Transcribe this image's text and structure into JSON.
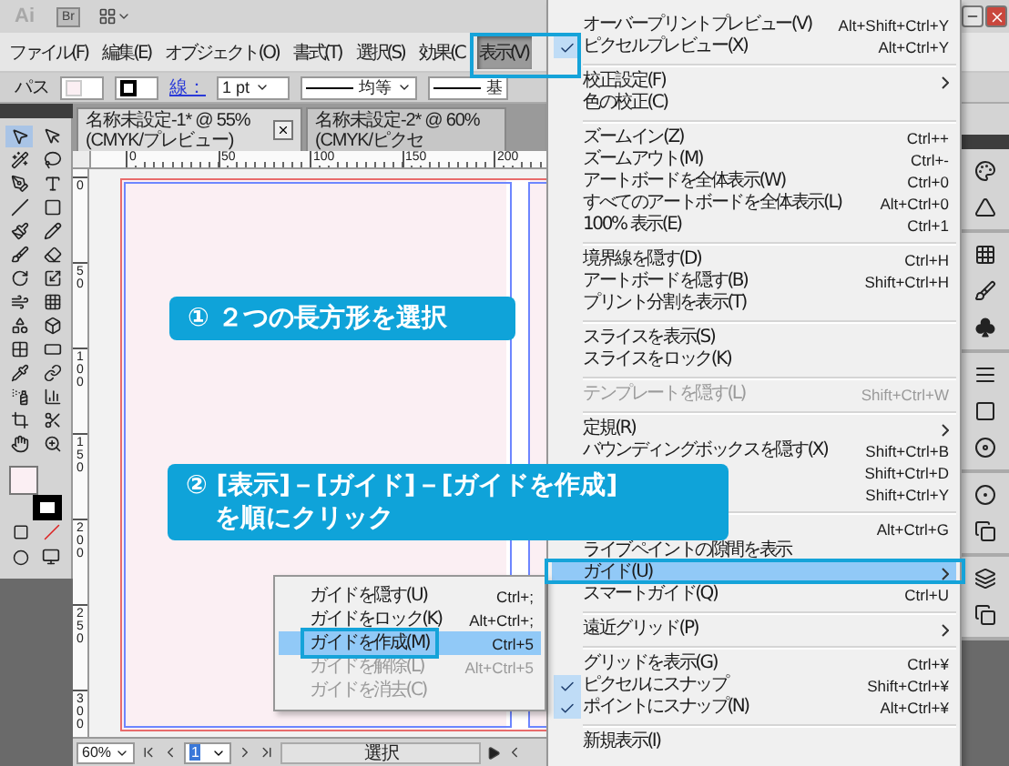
{
  "app_bar": {
    "logo": "Ai",
    "bridge": "Br"
  },
  "menubar": [
    {
      "label": "ファイル(F)",
      "selected": false
    },
    {
      "label": "編集(E)",
      "selected": false
    },
    {
      "label": "オブジェクト(O)",
      "selected": false
    },
    {
      "label": "書式(T)",
      "selected": false
    },
    {
      "label": "選択(S)",
      "selected": false
    },
    {
      "label": "効果(C",
      "selected": false
    },
    {
      "label": "表示(V)",
      "selected": true
    }
  ],
  "control_bar": {
    "selection": "パス",
    "stroke_link": "線：",
    "stroke_weight": "1 pt",
    "profile": "均等",
    "brush": "基"
  },
  "tabs": [
    {
      "label": "名称未設定-1* @ 55% (CMYK/プレビュー)",
      "selected": true
    },
    {
      "label": "名称未設定-2* @ 60% (CMYK/ピクセ",
      "selected": false
    }
  ],
  "rulers": {
    "horizontal": [
      "0",
      "50",
      "100",
      "150",
      "200"
    ],
    "vertical": [
      "0",
      "50",
      "100",
      "150",
      "200",
      "250",
      "300"
    ]
  },
  "callouts": [
    {
      "lines": [
        "① ２つの長方形を選択"
      ]
    },
    {
      "lines": [
        "② [表示]－[ガイド]－[ガイドを作成]",
        "を順にクリック"
      ]
    }
  ],
  "view_menu": [
    {
      "kind": "item",
      "label": "オーバープリントプレビュー(V)",
      "shortcut": "Alt+Shift+Ctrl+Y",
      "checked": false,
      "disabled": false,
      "selected": false,
      "submenu": false
    },
    {
      "kind": "item",
      "label": "ピクセルプレビュー(X)",
      "shortcut": "Alt+Ctrl+Y",
      "checked": true,
      "disabled": false,
      "selected": false,
      "submenu": false
    },
    {
      "kind": "separator"
    },
    {
      "kind": "item",
      "label": "校正設定(F)",
      "checked": false,
      "disabled": false,
      "selected": false,
      "submenu": true
    },
    {
      "kind": "item",
      "label": "色の校正(C)",
      "checked": false,
      "disabled": false,
      "selected": false,
      "submenu": false
    },
    {
      "kind": "separator"
    },
    {
      "kind": "item",
      "label": "ズームイン(Z)",
      "shortcut": "Ctrl++",
      "checked": false,
      "disabled": false,
      "selected": false,
      "submenu": false
    },
    {
      "kind": "item",
      "label": "ズームアウト(M)",
      "shortcut": "Ctrl+-",
      "checked": false,
      "disabled": false,
      "selected": false,
      "submenu": false
    },
    {
      "kind": "item",
      "label": "アートボードを全体表示(W)",
      "shortcut": "Ctrl+0",
      "checked": false,
      "disabled": false,
      "selected": false,
      "submenu": false
    },
    {
      "kind": "item",
      "label": "すべてのアートボードを全体表示(L)",
      "shortcut": "Alt+Ctrl+0",
      "checked": false,
      "disabled": false,
      "selected": false,
      "submenu": false
    },
    {
      "kind": "item",
      "label": "100% 表示(E)",
      "shortcut": "Ctrl+1",
      "checked": false,
      "disabled": false,
      "selected": false,
      "submenu": false
    },
    {
      "kind": "separator"
    },
    {
      "kind": "item",
      "label": "境界線を隠す(D)",
      "shortcut": "Ctrl+H",
      "checked": false,
      "disabled": false,
      "selected": false,
      "submenu": false
    },
    {
      "kind": "item",
      "label": "アートボードを隠す(B)",
      "shortcut": "Shift+Ctrl+H",
      "checked": false,
      "disabled": false,
      "selected": false,
      "submenu": false
    },
    {
      "kind": "item",
      "label": "プリント分割を表示(T)",
      "checked": false,
      "disabled": false,
      "selected": false,
      "submenu": false
    },
    {
      "kind": "separator"
    },
    {
      "kind": "item",
      "label": "スライスを表示(S)",
      "checked": false,
      "disabled": false,
      "selected": false,
      "submenu": false
    },
    {
      "kind": "item",
      "label": "スライスをロック(K)",
      "checked": false,
      "disabled": false,
      "selected": false,
      "submenu": false
    },
    {
      "kind": "separator"
    },
    {
      "kind": "item",
      "label": "テンプレートを隠す(L)",
      "shortcut": "Shift+Ctrl+W",
      "checked": false,
      "disabled": true,
      "selected": false,
      "submenu": false
    },
    {
      "kind": "separator"
    },
    {
      "kind": "item",
      "label": "定規(R)",
      "checked": false,
      "disabled": false,
      "selected": false,
      "submenu": true
    },
    {
      "kind": "item",
      "label": "バウンディングボックスを隠す(X)",
      "shortcut": "Shift+Ctrl+B",
      "checked": false,
      "disabled": false,
      "selected": false,
      "submenu": false
    },
    {
      "kind": "item",
      "shortcut": "Shift+Ctrl+D",
      "checked": false,
      "disabled": false,
      "selected": false,
      "submenu": false
    },
    {
      "kind": "item",
      "shortcut": "Shift+Ctrl+Y",
      "disabled": false,
      "selected": false,
      "submenu": false
    },
    {
      "kind": "separator"
    },
    {
      "kind": "item",
      "shortcut": "Alt+Ctrl+G",
      "disabled": false,
      "selected": false,
      "submenu": false
    },
    {
      "kind": "item",
      "label": "ライブペイントの隙間を表示",
      "checked": false,
      "disabled": false,
      "selected": false,
      "submenu": false
    },
    {
      "kind": "item",
      "label": "ガイド(U)",
      "checked": false,
      "disabled": false,
      "selected": true,
      "submenu": true
    },
    {
      "kind": "item",
      "label": "スマートガイド(Q)",
      "shortcut": "Ctrl+U",
      "checked": false,
      "disabled": false,
      "selected": false,
      "submenu": false
    },
    {
      "kind": "separator"
    },
    {
      "kind": "item",
      "label": "遠近グリッド(P)",
      "checked": false,
      "disabled": false,
      "selected": false,
      "submenu": true
    },
    {
      "kind": "separator"
    },
    {
      "kind": "item",
      "label": "グリッドを表示(G)",
      "shortcut": "Ctrl+¥",
      "checked": false,
      "disabled": false,
      "selected": false,
      "submenu": false
    },
    {
      "kind": "item",
      "label": "ピクセルにスナップ",
      "shortcut": "Shift+Ctrl+¥",
      "checked": true,
      "disabled": false,
      "selected": false,
      "submenu": false
    },
    {
      "kind": "item",
      "label": "ポイントにスナップ(N)",
      "shortcut": "Alt+Ctrl+¥",
      "checked": true,
      "disabled": false,
      "selected": false,
      "submenu": false
    },
    {
      "kind": "separator"
    },
    {
      "kind": "item",
      "label": "新規表示(I)",
      "checked": false,
      "disabled": false,
      "selected": false,
      "submenu": false
    }
  ],
  "guide_submenu": [
    {
      "label": "ガイドを隠す(U)",
      "shortcut": "Ctrl+;",
      "disabled": false,
      "selected": false
    },
    {
      "label": "ガイドをロック(K)",
      "shortcut": "Alt+Ctrl+;",
      "disabled": false,
      "selected": false
    },
    {
      "label": "ガイドを作成(M)",
      "shortcut": "Ctrl+5",
      "disabled": false,
      "selected": true
    },
    {
      "label": "ガイドを解除(L)",
      "shortcut": "Alt+Ctrl+5",
      "disabled": true,
      "selected": false
    },
    {
      "label": "ガイドを消去(C)",
      "disabled": true,
      "selected": false
    }
  ],
  "status_bar": {
    "zoom": "60%",
    "page": "1",
    "tool": "選択"
  }
}
